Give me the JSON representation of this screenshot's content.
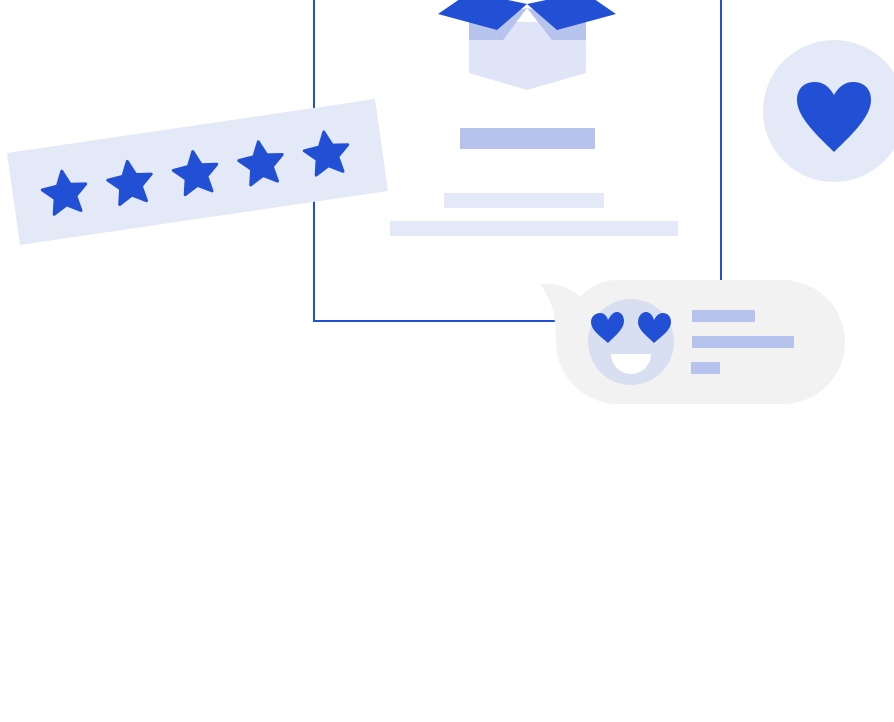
{
  "colors": {
    "primary": "#2150d4",
    "light_blue": "#e4e9f8",
    "mid_blue": "#b6c3ec",
    "box_light": "#dfe4f6",
    "bubble_gray": "#f2f2f2",
    "face_gray": "#d8dff0",
    "white": "#ffffff"
  },
  "rating": {
    "stars": 5,
    "max": 5
  },
  "icons": [
    "open-box-icon",
    "star-icon",
    "heart-icon",
    "heart-eyes-emoji-icon"
  ]
}
